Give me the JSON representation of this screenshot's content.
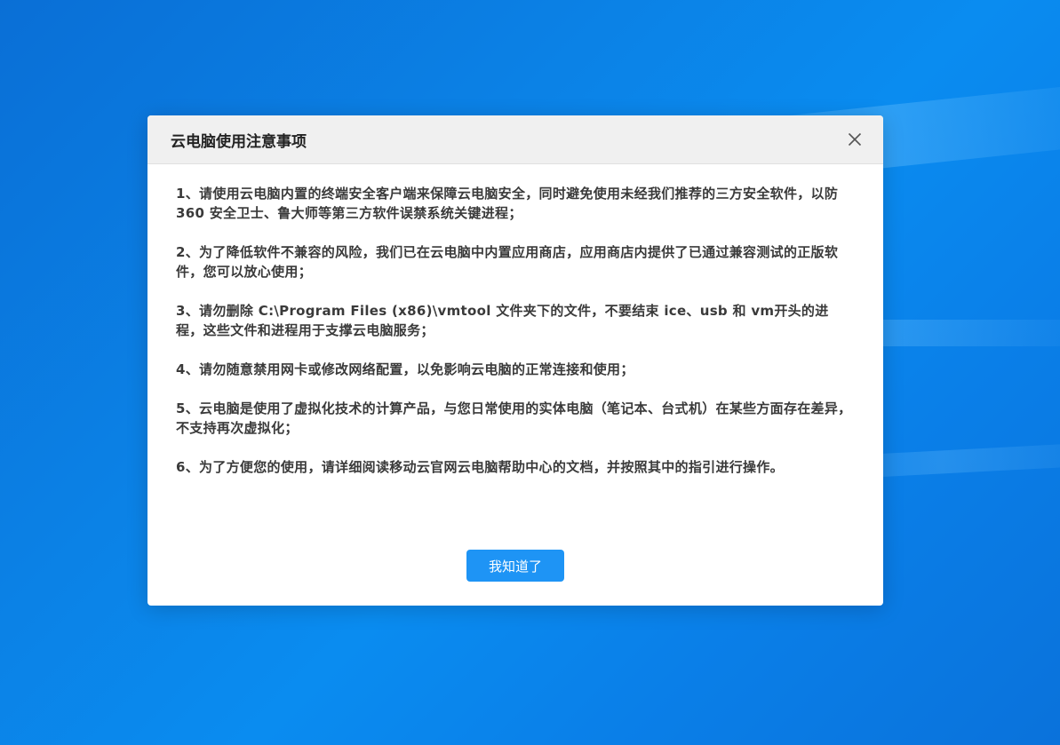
{
  "dialog": {
    "title": "云电脑使用注意事项",
    "close_icon": "close-icon",
    "items": [
      "1、请使用云电脑内置的终端安全客户端来保障云电脑安全，同时避免使用未经我们推荐的三方安全软件，以防 360 安全卫士、鲁大师等第三方软件误禁系统关键进程；",
      "2、为了降低软件不兼容的风险，我们已在云电脑中内置应用商店，应用商店内提供了已通过兼容测试的正版软件，您可以放心使用；",
      "3、请勿删除 C:\\Program Files (x86)\\vmtool 文件夹下的文件，不要结束 ice、usb 和 vm开头的进程，这些文件和进程用于支撑云电脑服务；",
      "4、请勿随意禁用网卡或修改网络配置，以免影响云电脑的正常连接和使用；",
      "5、云电脑是使用了虚拟化技术的计算产品，与您日常使用的实体电脑（笔记本、台式机）在某些方面存在差异，不支持再次虚拟化；",
      "6、为了方便您的使用，请详细阅读移动云官网云电脑帮助中心的文档，并按照其中的指引进行操作。"
    ],
    "ok_label": "我知道了"
  },
  "colors": {
    "accent": "#1e94f5",
    "desktop": "#0a82e6"
  }
}
